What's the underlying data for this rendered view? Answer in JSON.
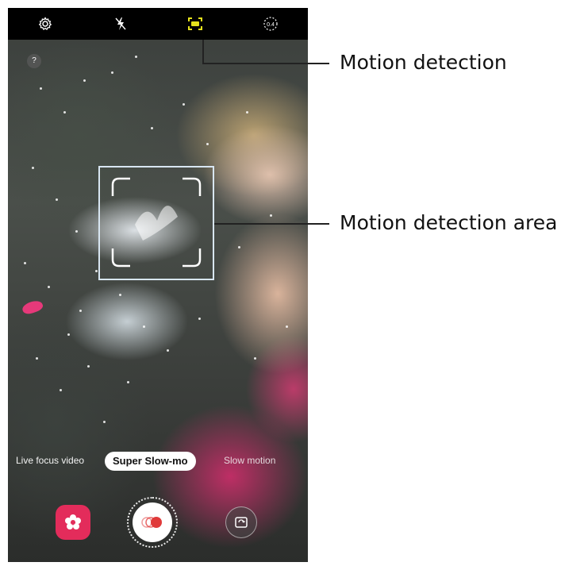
{
  "camera": {
    "top_bar": {
      "settings_icon": "gear-icon",
      "flash_icon": "flash-off-icon",
      "motion_detection_icon": "motion-detection-icon",
      "timer_icon": "timer-icon",
      "timer_value": "0.4"
    },
    "help_icon": "?",
    "modes": {
      "left": "Live focus video",
      "active": "Super Slow-mo",
      "right": "Slow motion"
    },
    "buttons": {
      "filter_icon": "filter-flower-icon",
      "record_icon": "record-icon",
      "switch_camera_icon": "switch-camera-icon"
    }
  },
  "callouts": {
    "motion_detection": "Motion detection",
    "motion_detection_area": "Motion detection area"
  },
  "colors": {
    "motion_icon_accent": "#e5e21c",
    "filter_button": "#e32c5b",
    "record_red": "#e03a3a",
    "frame_border": "#d8e6f2"
  }
}
